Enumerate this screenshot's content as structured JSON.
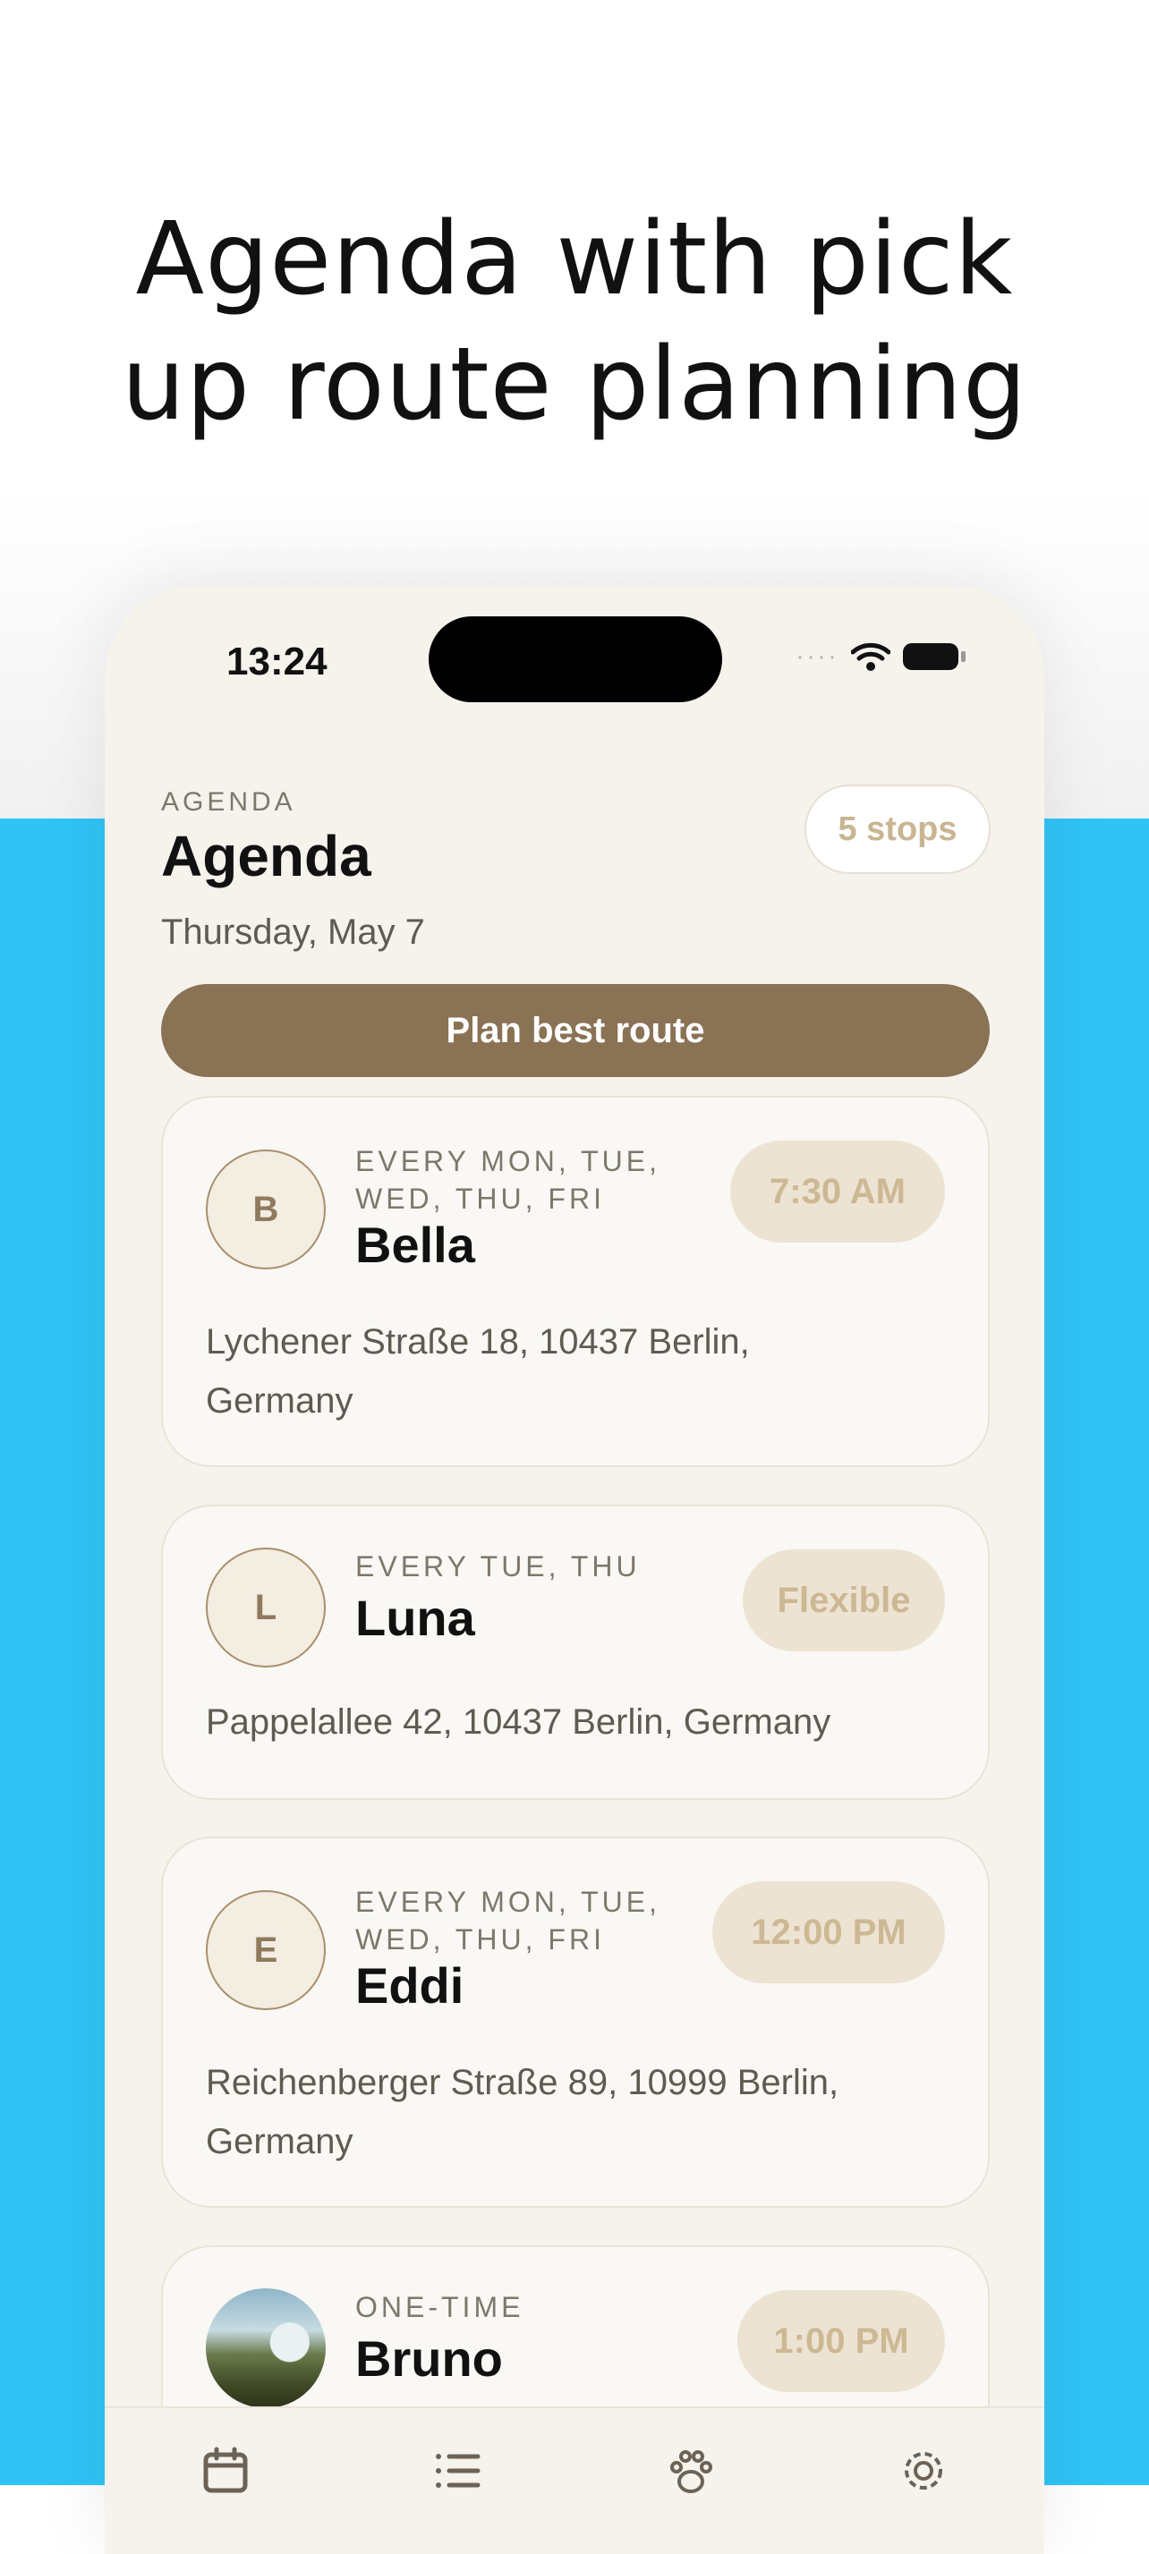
{
  "headline": {
    "line1": "Agenda with pick",
    "line2": "up route planning"
  },
  "status_bar": {
    "time": "13:24",
    "dots": "····"
  },
  "agenda": {
    "kicker": "AGENDA",
    "title": "Agenda",
    "date": "Thursday, May 7",
    "stops": "5 stops",
    "plan_button": "Plan best route"
  },
  "cards": [
    {
      "initial": "B",
      "schedule_1": "EVERY MON, TUE,",
      "schedule_2": "WED, THU, FRI",
      "name": "Bella",
      "time": "7:30 AM",
      "address_1": "Lychener Straße 18, 10437 Berlin,",
      "address_2": "Germany"
    },
    {
      "initial": "L",
      "schedule_1": "EVERY TUE, THU",
      "name": "Luna",
      "time": "Flexible",
      "address_1": "Pappelallee 42, 10437 Berlin, Germany"
    },
    {
      "initial": "E",
      "schedule_1": "EVERY MON, TUE,",
      "schedule_2": "WED, THU, FRI",
      "name": "Eddi",
      "time": "12:00 PM",
      "address_1": "Reichenberger Straße 89, 10999 Berlin,",
      "address_2": "Germany"
    },
    {
      "schedule_1": "ONE-TIME",
      "name": "Bruno",
      "time": "1:00 PM"
    }
  ],
  "tab_icons": [
    "calendar-icon",
    "list-icon",
    "paw-icon",
    "gear-icon"
  ],
  "colors": {
    "accent": "#8a7255",
    "background_blue": "#30c4f6",
    "phone_bg": "#f6f3ed"
  }
}
